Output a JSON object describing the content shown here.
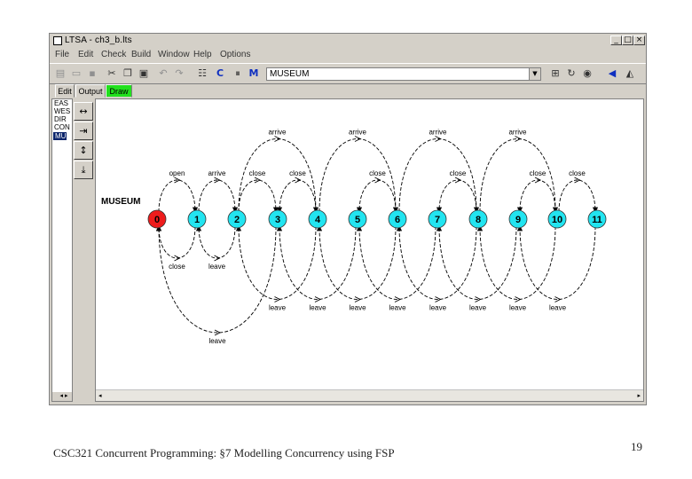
{
  "window": {
    "title": "LTSA - ch3_b.lts",
    "buttons": [
      "_",
      "□",
      "×"
    ]
  },
  "menu": [
    "File",
    "Edit",
    "Check",
    "Build",
    "Window",
    "Help",
    "Options"
  ],
  "toolbar": {
    "icons": [
      "new-icon",
      "open-icon",
      "save-icon",
      "cut-icon",
      "copy-icon",
      "paste-icon",
      "undo-icon",
      "redo-icon",
      "stop-icon",
      "compile-icon",
      "compose-icon",
      "minimise-icon",
      "safety-icon",
      "progress-icon",
      "run-icon",
      "back-icon",
      "forward-icon"
    ],
    "process_select": "MUSEUM"
  },
  "tabs": [
    "Edit",
    "Output",
    "Draw"
  ],
  "side_list": [
    "EAS",
    "WES",
    "DIR",
    "CON",
    "MU"
  ],
  "side_buttons": [
    "stretch-horizontal-icon",
    "shrink-horizontal-icon",
    "stretch-vertical-icon",
    "shrink-vertical-icon"
  ],
  "lts": {
    "process_name": "MUSEUM",
    "states": [
      "0",
      "1",
      "2",
      "3",
      "4",
      "5",
      "6",
      "7",
      "8",
      "9",
      "10",
      "11"
    ],
    "initial_state_color": "#ee1c1c",
    "state_color": "#22e4f0",
    "labels": {
      "open": "open",
      "arrive": "arrive",
      "close": "close",
      "leave": "leave"
    }
  },
  "footer": "CSC321 Concurrent Programming: §7 Modelling Concurrency using FSP",
  "page_number": "19"
}
